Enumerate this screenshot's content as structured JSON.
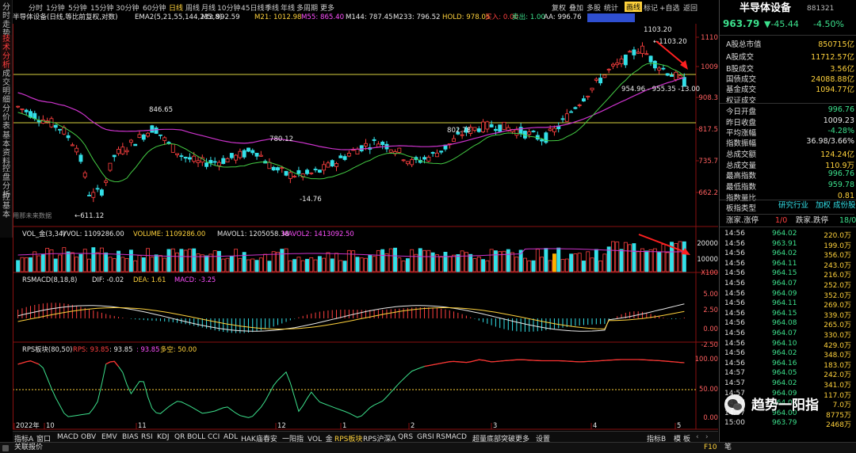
{
  "vertical_tabs": [
    "分时走势",
    "技术分析",
    "成交明细",
    "分价表",
    "基本资料",
    "控盘分析",
    "控基本"
  ],
  "period_tabs": [
    "分时",
    "1分钟",
    "5分钟",
    "15分钟",
    "30分钟",
    "60分钟",
    "日线",
    "周线",
    "月线",
    "10分钟",
    "45日线",
    "季线",
    "年线",
    "多周期",
    "更多"
  ],
  "active_period": "日线",
  "toolbar": {
    "restore": "复权",
    "compare": "叠加",
    "multi": "多股",
    "stats": "统计",
    "draw": "画线",
    "mark": "标记",
    "zoom": "+自选",
    "back": "返回"
  },
  "indicator_line": {
    "name": "半导体设备(日线,等比前复权,对数)",
    "ema_label": "EMA2(5,21,55,144,233,8)",
    "items": [
      {
        "k": "M5: 992.59",
        "color": "#e8e8e8"
      },
      {
        "k": "M21: 1012.98",
        "color": "#ffd23c"
      },
      {
        "k": "M55: 865.40",
        "color": "#ff50ff"
      },
      {
        "k": "M144: 787.45",
        "color": "#e8e8e8"
      },
      {
        "k": "M233: 796.52",
        "color": "#e8e8e8"
      },
      {
        "k": "HOLD: 978.05",
        "color": "#ffd23c"
      },
      {
        "k": "买入: 0.00",
        "color": "#ff4040"
      },
      {
        "k": "卖出: 1.00",
        "color": "#3ce08c"
      },
      {
        "k": "AA: 996.76",
        "color": "#e8e8e8"
      }
    ]
  },
  "price_axis": [
    "1110",
    "1009",
    "908.3",
    "817.5",
    "735.7",
    "662.2"
  ],
  "price_annotations": {
    "high1": "1103.20",
    "high2": "1103.20",
    "peak_nov": "846.65",
    "mid1": "780.12",
    "mid2": "802.78",
    "low": "611.12",
    "low2": "-14.76",
    "range": "954.96 - 955.35 -13.00",
    "hint": "用那未来数据"
  },
  "volume": {
    "label": "VOL_金(3,34)",
    "items": [
      {
        "k": "VVOL: 1109286.00",
        "color": "#e8e8e8"
      },
      {
        "k": "VOLUME: 1109286.00",
        "color": "#ffd23c"
      },
      {
        "k": "MAVOL1: 1205058.38",
        "color": "#e8e8e8"
      },
      {
        "k": "MAVOL2: 1413092.50",
        "color": "#ff50ff"
      }
    ],
    "axis": [
      "20000",
      "10000",
      "X100"
    ]
  },
  "rsmacd": {
    "label": "RSMACD(8,18,8)",
    "items": [
      {
        "k": "DIF: -0.02",
        "color": "#e8e8e8"
      },
      {
        "k": "DEA: 1.61",
        "color": "#ffd23c"
      },
      {
        "k": "MACD: -3.25",
        "color": "#ff50ff"
      }
    ],
    "axis": [
      "5.00",
      "2.50",
      "0.00",
      "-2.50"
    ]
  },
  "rps": {
    "label": "RPS板块(80,50)",
    "items": [
      {
        "k": "RPS: 93.85",
        "color": "#ff4040"
      },
      {
        "k": ": 93.85",
        "color": "#e8e8e8"
      },
      {
        "k": ": 93.85",
        "color": "#ff50ff"
      },
      {
        "k": "多空: 50.00",
        "color": "#ffd23c"
      }
    ],
    "axis": [
      "100.00",
      "50.00",
      "0.00"
    ]
  },
  "x_axis": [
    "2022年",
    "10",
    "11",
    "12",
    "1",
    "2",
    "3",
    "4",
    "5"
  ],
  "bottom_tabs": [
    "指标A",
    "窗口",
    "MACD",
    "OBV",
    "EMV",
    "BIAS",
    "RSI",
    "KDJ",
    "QR",
    "BOLL",
    "CCI",
    "ADL",
    "HAK庙春安",
    "一阳指",
    "VOL_金",
    "RPS板块",
    "RPS沪深A",
    "QRS",
    "GRSI",
    "RSMACD",
    "超量底部突破",
    "更多",
    "设置"
  ],
  "active_bottom_tab": "RPS板块",
  "bottom_right": {
    "a": "指标B",
    "b": "模",
    "c": "板"
  },
  "stock": {
    "name": "半导体设备",
    "code": "881321",
    "price": "963.79",
    "change": "▼-45.44",
    "pct": "-4.50%"
  },
  "stats": [
    {
      "k": "A股总市值",
      "v": "850715亿",
      "c": "#ffd23c"
    },
    {
      "k": "A股成交",
      "v": "11712.57亿",
      "c": "#ffd23c"
    },
    {
      "k": "B股成交",
      "v": "3.56亿",
      "c": "#ffd23c"
    },
    {
      "k": "国债成交",
      "v": "24088.88亿",
      "c": "#ffd23c"
    },
    {
      "k": "基金成交",
      "v": "1094.77亿",
      "c": "#ffd23c"
    },
    {
      "k": "权证成交",
      "v": "",
      "c": "#ffd23c"
    },
    {
      "k": "今日开盘",
      "v": "996.76",
      "c": "#3ce08c"
    },
    {
      "k": "昨日收盘",
      "v": "1009.23",
      "c": "#e8e8e8"
    },
    {
      "k": "平均涨幅",
      "v": "-4.28%",
      "c": "#3ce08c"
    },
    {
      "k": "指数振幅",
      "v": "36.98/3.66%",
      "c": "#e8e8e8"
    },
    {
      "k": "总成交额",
      "v": "124.24亿",
      "c": "#ffd23c"
    },
    {
      "k": "总成交量",
      "v": "110.9万",
      "c": "#ffd23c"
    },
    {
      "k": "最高指数",
      "v": "996.76",
      "c": "#3ce08c"
    },
    {
      "k": "最低指数",
      "v": "959.78",
      "c": "#3ce08c"
    },
    {
      "k": "指数量比",
      "v": "0.81",
      "c": "#ffd23c"
    }
  ],
  "board": {
    "k": "板指类型",
    "links": [
      "研究行业",
      "加权",
      "成份股"
    ]
  },
  "updown": {
    "k1": "涨家.涨停",
    "v1": "1/0",
    "k2": "跌家.跌停",
    "v2": "18/0"
  },
  "ticks": [
    {
      "t": "14:56",
      "p": "964.02",
      "v": "220.0万"
    },
    {
      "t": "14:56",
      "p": "963.91",
      "v": "199.0万"
    },
    {
      "t": "14:56",
      "p": "964.02",
      "v": "356.0万"
    },
    {
      "t": "14:56",
      "p": "964.11",
      "v": "243.0万"
    },
    {
      "t": "14:56",
      "p": "964.15",
      "v": "216.0万"
    },
    {
      "t": "14:56",
      "p": "964.07",
      "v": "252.0万"
    },
    {
      "t": "14:56",
      "p": "964.09",
      "v": "352.0万"
    },
    {
      "t": "14:56",
      "p": "964.11",
      "v": "269.0万"
    },
    {
      "t": "14:56",
      "p": "964.15",
      "v": "339.0万"
    },
    {
      "t": "14:56",
      "p": "964.08",
      "v": "265.0万"
    },
    {
      "t": "14:56",
      "p": "964.07",
      "v": "330.0万"
    },
    {
      "t": "14:56",
      "p": "964.10",
      "v": "429.0万"
    },
    {
      "t": "14:56",
      "p": "964.02",
      "v": "348.0万"
    },
    {
      "t": "14:56",
      "p": "964.16",
      "v": "183.0万"
    },
    {
      "t": "14:57",
      "p": "964.05",
      "v": "242.0万"
    },
    {
      "t": "14:57",
      "p": "964.02",
      "v": "341.0万"
    },
    {
      "t": "14:57",
      "p": "964.09",
      "v": "117.0万"
    },
    {
      "t": "14:57",
      "p": "964.09",
      "v": "7.0万"
    },
    {
      "t": "14:57",
      "p": "964.00",
      "v": "8775万"
    },
    {
      "t": "15:00",
      "p": "963.79",
      "v": "2468万"
    }
  ],
  "watermark": "趋势一阳指",
  "status": {
    "left": "关联报价",
    "right": "F10",
    "side": "笔"
  }
}
